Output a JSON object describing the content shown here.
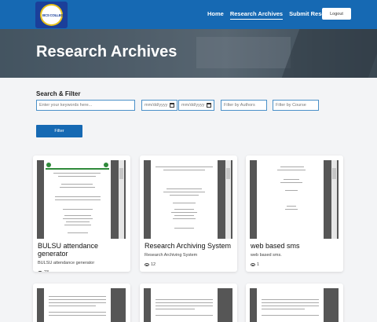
{
  "nav": {
    "logo_text": "BCS COLLEGE",
    "links": [
      "Home",
      "Research Archives",
      "Submit Research"
    ],
    "logout_label": "Logout"
  },
  "hero": {
    "title": "Research Archives"
  },
  "search": {
    "label": "Search & Filter",
    "keyword_placeholder": "Enter your keywords here...",
    "date_from": "mm/dd/yyyy",
    "date_to": "mm/dd/yyyy",
    "author_placeholder": "Filter by Authors",
    "course_placeholder": "Filter by Course",
    "filter_label": "Filter"
  },
  "cards": [
    {
      "title": "BULSU attendance generator",
      "description": "BULSU attendance generator",
      "views": "23"
    },
    {
      "title": "Research Archiving System",
      "description": "Research Archiving System",
      "views": "12"
    },
    {
      "title": "web based sms",
      "description": "web based sms.",
      "views": "1"
    }
  ]
}
